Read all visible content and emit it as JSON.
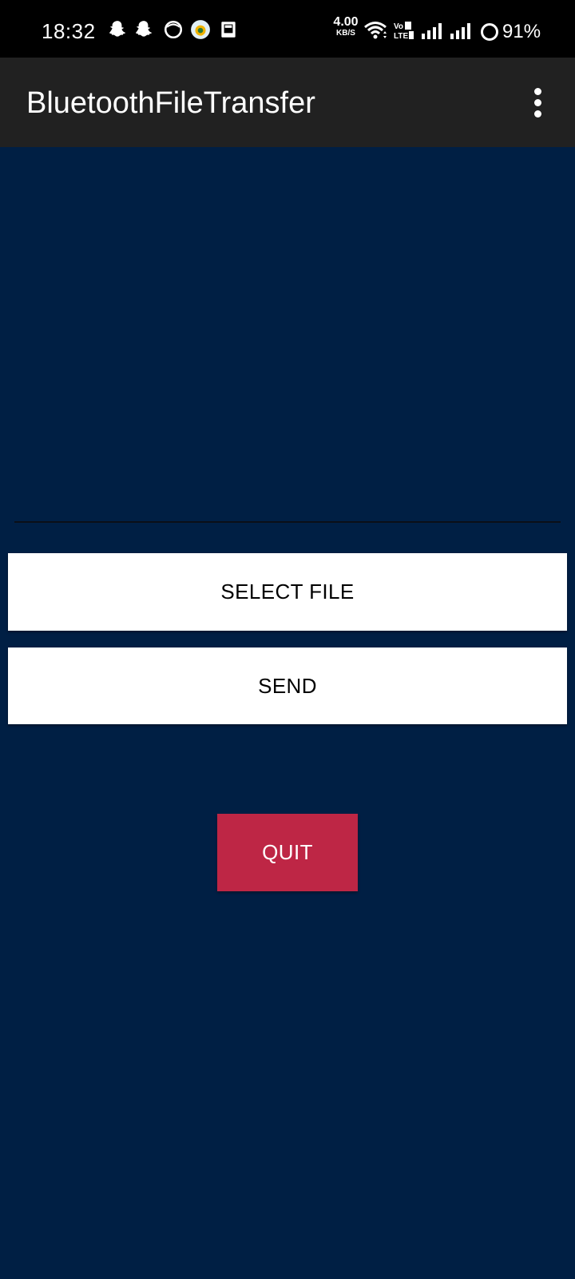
{
  "status_bar": {
    "time": "18:32",
    "net_speed_value": "4.00",
    "net_speed_unit": "KB/S",
    "volte_label_top": "Vo",
    "volte_label_bottom": "LTE",
    "battery_percent": "91%",
    "notification_icons": [
      "snapchat-icon",
      "snapchat-icon",
      "face-icon",
      "app-icon",
      "cast-icon"
    ],
    "system_icons": [
      "wifi-icon",
      "volte-icon",
      "signal-icon",
      "signal-icon",
      "battery-ring-icon"
    ]
  },
  "app_bar": {
    "title": "BluetoothFileTransfer",
    "overflow_icon": "more-vert-icon",
    "background_color": "#212121"
  },
  "main": {
    "background_color": "#001f44",
    "buttons": {
      "select_file": "SELECT FILE",
      "send": "SEND",
      "quit": "QUIT"
    },
    "quit_color": "#be2645"
  }
}
